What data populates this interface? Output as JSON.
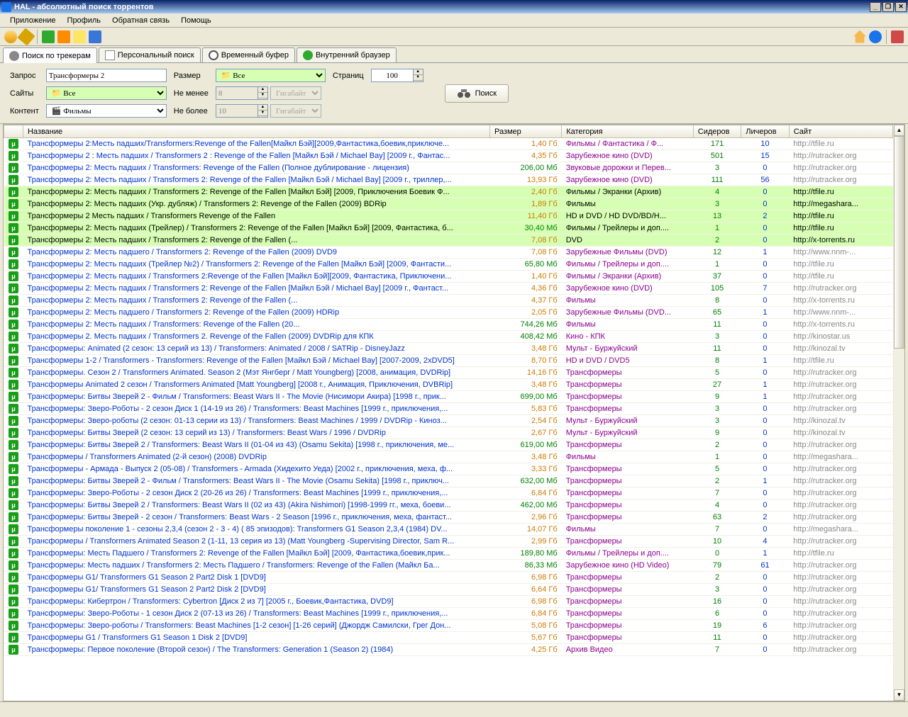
{
  "window": {
    "title": "HAL - абсолютный поиск торрентов"
  },
  "menu": {
    "app": "Приложение",
    "profile": "Профиль",
    "feedback": "Обратная связь",
    "help": "Помощь"
  },
  "tabs": {
    "search": "Поиск по трекерам",
    "personal": "Персональный поиск",
    "buffer": "Временный буфер",
    "browser": "Внутренний браузер"
  },
  "search": {
    "label_query": "Запрос",
    "label_sites": "Сайты",
    "label_content": "Контент",
    "label_size": "Размер",
    "label_min": "Не менее",
    "label_max": "Не более",
    "label_pages": "Страниц",
    "query_value": "Трансформеры 2",
    "sites_value": "Все",
    "content_value": "Фильмы",
    "size_value": "Все",
    "min_value": "8",
    "max_value": "10",
    "unit": "Гигабайт",
    "pages_value": "100",
    "button": "Поиск"
  },
  "columns": {
    "name": "Название",
    "size": "Размер",
    "category": "Категория",
    "seeders": "Сидеров",
    "leechers": "Личеров",
    "site": "Сайт"
  },
  "rows": [
    {
      "name": "Трансформеры 2:Месть падших/Transformers:Revenge of the Fallen[Майкл Бэй][2009,Фантастика,боевик,приключе...",
      "size": "1,40 Гб",
      "szg": false,
      "cat": "Фильмы / Фантастика / Ф...",
      "seed": 171,
      "leech": 10,
      "site": "http://tfile.ru",
      "hl": false
    },
    {
      "name": "Трансформеры 2 : Месть падших / Transformers 2 : Revenge of the Fallen [Майкл Бэй / Michael Bay] [2009 г., Фантас...",
      "size": "4,35 Гб",
      "szg": false,
      "cat": "Зарубежное кино (DVD)",
      "seed": 501,
      "leech": 15,
      "site": "http://rutracker.org",
      "hl": false
    },
    {
      "name": "Трансформеры 2: Месть падших / Transformers: Revenge of the Fallen (Полное дублирование - лицензия)",
      "size": "206,00 Мб",
      "szg": true,
      "cat": "Звуковые дорожки и Перев...",
      "seed": 3,
      "leech": 0,
      "site": "http://rutracker.org",
      "hl": false
    },
    {
      "name": "Трансформеры 2: Месть падших / Transformers 2: Revenge of the Fallen [Майкл Бэй / Michael Bay] [2009 г., триллер,...",
      "size": "13,93 Гб",
      "szg": false,
      "cat": "Зарубежное кино (DVD)",
      "seed": 111,
      "leech": 56,
      "site": "http://rutracker.org",
      "hl": false
    },
    {
      "name": "Трансформеры 2: Месть падших / Transformers 2: Revenge of the Fallen [Майкл Бэй] [2009, Приключения Боевик Ф...",
      "size": "2,40 Гб",
      "szg": false,
      "cat": "Фильмы / Экранки (Архив)",
      "seed": 4,
      "leech": 0,
      "site": "http://tfile.ru",
      "hl": true
    },
    {
      "name": "Трансформеры 2: Месть падших (Укр. дубляж) / Transformers 2: Revenge of the Fallen  (2009) BDRip",
      "size": "1,89 Гб",
      "szg": false,
      "cat": "Фильмы",
      "seed": 3,
      "leech": 0,
      "site": "http://megashara...",
      "hl": true
    },
    {
      "name": "Трансформеры 2 Месть падших / Transformers Revenge of the Fallen",
      "size": "11,40 Гб",
      "szg": false,
      "cat": "HD и DVD / HD DVD/BD/H...",
      "seed": 13,
      "leech": 2,
      "site": "http://tfile.ru",
      "hl": true
    },
    {
      "name": "Трансформеры 2: Месть падших (Трейлер) / Transformers 2: Revenge of the Fallen [Майкл Бэй] [2009, Фантастика, б...",
      "size": "30,40 Мб",
      "szg": true,
      "cat": "Фильмы / Трейлеры и доп....",
      "seed": 1,
      "leech": 0,
      "site": "http://tfile.ru",
      "hl": true
    },
    {
      "name": "Трансформеры 2: Месть падших / Transformers 2: Revenge of the Fallen (...",
      "size": "7,08 Гб",
      "szg": false,
      "cat": "DVD",
      "seed": 2,
      "leech": 0,
      "site": "http://x-torrents.ru",
      "hl": true
    },
    {
      "name": "Трансформеры 2: Месть падшего / Transformers 2: Revenge of the Fallen (2009) DVD9",
      "size": "7,08 Гб",
      "szg": false,
      "cat": "Зарубежные Фильмы (DVD)",
      "seed": 12,
      "leech": 1,
      "site": "http://www.nnm-...",
      "hl": false
    },
    {
      "name": "Трансформеры 2: Месть падших (Трейлер №2) / Transformers 2: Revenge of the Fallen [Майкл Бэй] [2009, Фантасти...",
      "size": "65,80 Мб",
      "szg": true,
      "cat": "Фильмы / Трейлеры и доп....",
      "seed": 1,
      "leech": 0,
      "site": "http://tfile.ru",
      "hl": false
    },
    {
      "name": "Трансформеры 2: Месть падших / Transformers 2:Revenge of the Fallen [Майкл Бэй][2009, Фантастика, Приключени...",
      "size": "1,40 Гб",
      "szg": false,
      "cat": "Фильмы / Экранки (Архив)",
      "seed": 37,
      "leech": 0,
      "site": "http://tfile.ru",
      "hl": false
    },
    {
      "name": "Трансформеры 2: Месть падших / Transformers 2: Revenge of the Fallen [Майкл Бэй / Michael Bay] [2009 г., Фантаст...",
      "size": "4,36 Гб",
      "szg": false,
      "cat": "Зарубежное кино (DVD)",
      "seed": 105,
      "leech": 7,
      "site": "http://rutracker.org",
      "hl": false
    },
    {
      "name": "Трансформеры 2: Месть падших / Transformers 2: Revenge of the Fallen (...",
      "size": "4,37 Гб",
      "szg": false,
      "cat": "Фильмы",
      "seed": 8,
      "leech": 0,
      "site": "http://x-torrents.ru",
      "hl": false
    },
    {
      "name": "Трансформеры 2: Месть падшего / Transformers 2: Revenge of the Fallen (2009) HDRip",
      "size": "2,05 Гб",
      "szg": false,
      "cat": "Зарубежные Фильмы (DVD...",
      "seed": 65,
      "leech": 1,
      "site": "http://www.nnm-...",
      "hl": false
    },
    {
      "name": "Трансформеры 2: Месть падших / Transformers: Revenge of the Fallen (20...",
      "size": "744,26 Мб",
      "szg": true,
      "cat": "Фильмы",
      "seed": 11,
      "leech": 0,
      "site": "http://x-torrents.ru",
      "hl": false
    },
    {
      "name": "Трансформеры 2.  Месть падших / Transformers 2.  Revenge of the Fallen (2009) DVDRip для КПК",
      "size": "408,42 Мб",
      "szg": true,
      "cat": "Кино - КПК",
      "seed": 3,
      "leech": 0,
      "site": "http://kinostar.us",
      "hl": false
    },
    {
      "name": "Трансформеры: Animated (2 сезон: 13 серий из 13) / Transformers: Animated / 2008 / SATRip - DisneyJazz",
      "size": "3,48 Гб",
      "szg": false,
      "cat": "Мульт - Буржуйский",
      "seed": 11,
      "leech": 0,
      "site": "http://kinozal.tv",
      "hl": false
    },
    {
      "name": "Трансформеры 1-2 / Transformers -  Transformers: Revenge of the Fallen [Майкл Бэй / Michael Bay] [2007-2009, 2xDVD5]",
      "size": "8,70 Гб",
      "szg": false,
      "cat": "HD и DVD / DVD5",
      "seed": 8,
      "leech": 1,
      "site": "http://tfile.ru",
      "hl": false
    },
    {
      "name": "Трансформеры. Сезон 2 / Transformers Animated. Season 2 (Мэт Янгберг / Matt Youngberg) [2008, анимация, DVDRip]",
      "size": "14,16 Гб",
      "szg": false,
      "cat": "Трансформеры",
      "seed": 5,
      "leech": 0,
      "site": "http://rutracker.org",
      "hl": false
    },
    {
      "name": "Трансформеры Animated 2 сезон / Transformers Animated [Matt Youngberg] [2008 г., Анимация, Приключения, DVBRip]",
      "size": "3,48 Гб",
      "szg": false,
      "cat": "Трансформеры",
      "seed": 27,
      "leech": 1,
      "site": "http://rutracker.org",
      "hl": false
    },
    {
      "name": "Трансформеры: Битвы Зверей 2 - Фильм / Transformers: Beast Wars II - The Movie (Нисимори Акира) [1998 г., прик...",
      "size": "699,00 Мб",
      "szg": true,
      "cat": "Трансформеры",
      "seed": 9,
      "leech": 1,
      "site": "http://rutracker.org",
      "hl": false
    },
    {
      "name": "Трансформеры: Зверо-Роботы - 2 сезон Диск 1 (14-19 из 26) / Transformers: Beast Machines [1999 г., приключения,...",
      "size": "5,83 Гб",
      "szg": false,
      "cat": "Трансформеры",
      "seed": 3,
      "leech": 0,
      "site": "http://rutracker.org",
      "hl": false
    },
    {
      "name": "Трансформеры: Зверо-роботы (2 сезон: 01-13 серии из 13) / Transformers: Beast Machines / 1999 / DVDRip - Киноз...",
      "size": "2,54 Гб",
      "szg": false,
      "cat": "Мульт - Буржуйский",
      "seed": 3,
      "leech": 0,
      "site": "http://kinozal.tv",
      "hl": false
    },
    {
      "name": "Трансформеры: Битвы Зверей (2 сезон: 13 серий из 13) / Transformers: Beast Wars / 1996 / DVDRip",
      "size": "2,67 Гб",
      "szg": false,
      "cat": "Мульт - Буржуйский",
      "seed": 9,
      "leech": 0,
      "site": "http://kinozal.tv",
      "hl": false
    },
    {
      "name": "Трансформеры: Битвы Зверей 2 / Transformers: Beast Wars II (01-04 из 43) (Osamu Sekita) [1998 г., приключения, ме...",
      "size": "619,00 Мб",
      "szg": true,
      "cat": "Трансформеры",
      "seed": 2,
      "leech": 0,
      "site": "http://rutracker.org",
      "hl": false
    },
    {
      "name": "Трансформеры / Transformers Animated (2-й сезон) (2008) DVDRip",
      "size": "3,48 Гб",
      "szg": false,
      "cat": "Фильмы",
      "seed": 1,
      "leech": 0,
      "site": "http://megashara...",
      "hl": false
    },
    {
      "name": "Трансформеры - Армада - Выпуск 2 (05-08) / Transformers - Armada (Хидехито Уеда) [2002 г., приключения, меха, ф...",
      "size": "3,33 Гб",
      "szg": false,
      "cat": "Трансформеры",
      "seed": 5,
      "leech": 0,
      "site": "http://rutracker.org",
      "hl": false
    },
    {
      "name": "Трансформеры: Битвы Зверей 2 - Фильм / Transformers: Beast Wars II - The Movie (Osamu Sekita) [1998 г., приключ...",
      "size": "632,00 Мб",
      "szg": true,
      "cat": "Трансформеры",
      "seed": 2,
      "leech": 1,
      "site": "http://rutracker.org",
      "hl": false
    },
    {
      "name": "Трансформеры: Зверо-Роботы - 2 сезон Диск 2 (20-26 из 26) / Transformers: Beast Machines [1999 г., приключения,...",
      "size": "6,84 Гб",
      "szg": false,
      "cat": "Трансформеры",
      "seed": 7,
      "leech": 0,
      "site": "http://rutracker.org",
      "hl": false
    },
    {
      "name": "Трансформеры: Битвы Зверей 2 / Transformers: Beast Wars II (02 из 43) (Akira Nishimori) [1998-1999 гг., меха, боеви...",
      "size": "462,00 Мб",
      "szg": true,
      "cat": "Трансформеры",
      "seed": 4,
      "leech": 0,
      "site": "http://rutracker.org",
      "hl": false
    },
    {
      "name": "Трансформеры: Битвы Зверей - 2 сезон / Transformers: Beast Wars - 2 Season [1996 г., приключения, меха, фантаст...",
      "size": "2,96 Гб",
      "szg": false,
      "cat": "Трансформеры",
      "seed": 63,
      "leech": 2,
      "site": "http://rutracker.org",
      "hl": false
    },
    {
      "name": "Трансформеры поколение 1 - сезоны 2,3,4 (сезон 2 - 3 - 4) ( 85 эпизодов): Transformers G1 Season 2,3,4 (1984) DV...",
      "size": "14,07 Гб",
      "szg": false,
      "cat": "Фильмы",
      "seed": 7,
      "leech": 0,
      "site": "http://megashara...",
      "hl": false
    },
    {
      "name": "Трансформеры / Transformers Animated Season 2 (1-11, 13 серия из 13) (Matt Youngberg -Supervising Director, Sam R...",
      "size": "2,99 Гб",
      "szg": false,
      "cat": "Трансформеры",
      "seed": 10,
      "leech": 4,
      "site": "http://rutracker.org",
      "hl": false
    },
    {
      "name": "Трансформеры: Месть Падшего / Transformers 2: Revenge of the Fallen [Майкл Бэй] [2009, Фантастика,боевик,прик...",
      "size": "189,80 Мб",
      "szg": true,
      "cat": "Фильмы / Трейлеры и доп....",
      "seed": 0,
      "leech": 1,
      "site": "http://tfile.ru",
      "hl": false
    },
    {
      "name": "Трансформеры: Месть падших / Transformers 2: Месть Падшего / Transformers: Revenge of the Fallen (Майкл Ба...",
      "size": "86,33 Мб",
      "szg": true,
      "cat": "Зарубежное кино (HD Video)",
      "seed": 79,
      "leech": 61,
      "site": "http://rutracker.org",
      "hl": false
    },
    {
      "name": "Трансформеры G1/ Transformers G1 Season 2 Part2 Disk 1 [DVD9]",
      "size": "6,98 Гб",
      "szg": false,
      "cat": "Трансформеры",
      "seed": 2,
      "leech": 0,
      "site": "http://rutracker.org",
      "hl": false
    },
    {
      "name": "Трансформеры G1/ Transformers G1 Season 2 Part2 Disk 2 [DVD9]",
      "size": "6,64 Гб",
      "szg": false,
      "cat": "Трансформеры",
      "seed": 3,
      "leech": 0,
      "site": "http://rutracker.org",
      "hl": false
    },
    {
      "name": "Трансформеры: Кибертрон / Transformers: Cybertron [Диск 2 из 7] [2005 г., Боевик,Фантастика, DVD9]",
      "size": "6,98 Гб",
      "szg": false,
      "cat": "Трансформеры",
      "seed": 16,
      "leech": 0,
      "site": "http://rutracker.org",
      "hl": false
    },
    {
      "name": "Трансформеры: Зверо-Роботы - 1 сезон Диск 2 (07-13 из 26) / Transformers: Beast Machines [1999 г., приключения,...",
      "size": "6,84 Гб",
      "szg": false,
      "cat": "Трансформеры",
      "seed": 6,
      "leech": 0,
      "site": "http://rutracker.org",
      "hl": false
    },
    {
      "name": "Трансформеры: Зверо-роботы / Transformers: Beast Machines [1-2 сезон] [1-26 серий] (Джордж Самилски, Грег Дон...",
      "size": "5,08 Гб",
      "szg": false,
      "cat": "Трансформеры",
      "seed": 19,
      "leech": 6,
      "site": "http://rutracker.org",
      "hl": false
    },
    {
      "name": "Трансформеры G1 / Transformers G1 Season 1 Disk 2 [DVD9]",
      "size": "5,67 Гб",
      "szg": false,
      "cat": "Трансформеры",
      "seed": 11,
      "leech": 0,
      "site": "http://rutracker.org",
      "hl": false
    },
    {
      "name": "Трансформеры: Первое поколение (Второй сезон) / The Transformers: Generation 1 (Season 2) (1984)",
      "size": "4,25 Гб",
      "szg": false,
      "cat": "Архив Видео",
      "seed": 7,
      "leech": 0,
      "site": "http://rutracker.org",
      "hl": false
    }
  ]
}
